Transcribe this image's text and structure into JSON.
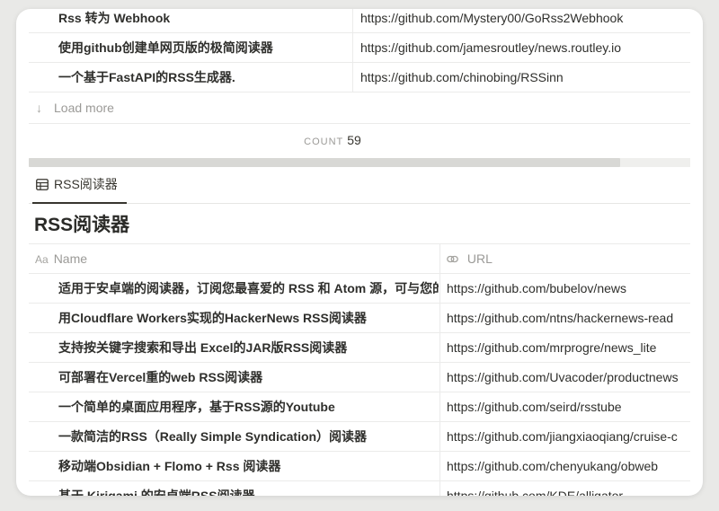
{
  "top_table": {
    "rows": [
      {
        "name": "Rss 转为 Webhook",
        "url": "https://github.com/Mystery00/GoRss2Webhook"
      },
      {
        "name": "使用github创建单网页版的极简阅读器",
        "url": "https://github.com/jamesroutley/news.routley.io"
      },
      {
        "name": "一个基于FastAPI的RSS生成器.",
        "url": "https://github.com/chinobing/RSSinn"
      }
    ],
    "load_more": "Load more",
    "count_label": "COUNT",
    "count_value": "59"
  },
  "view_tab": {
    "label": "RSS阅读器",
    "icon": "table-icon"
  },
  "db": {
    "title": "RSS阅读器",
    "columns": {
      "name": "Name",
      "name_icon": "Aa",
      "url": "URL"
    },
    "rows": [
      {
        "name": "适用于安卓端的阅读器，订阅您最喜爱的 RSS 和 Atom 源，可与您的",
        "url": "https://github.com/bubelov/news"
      },
      {
        "name": "用Cloudflare Workers实现的HackerNews RSS阅读器",
        "url": "https://github.com/ntns/hackernews-read"
      },
      {
        "name": "支持按关键字搜索和导出 Excel的JAR版RSS阅读器",
        "url": "https://github.com/mrprogre/news_lite"
      },
      {
        "name": "可部署在Vercel重的web RSS阅读器",
        "url": "https://github.com/Uvacoder/productnews"
      },
      {
        "name": "一个简单的桌面应用程序，基于RSS源的Youtube",
        "url": "https://github.com/seird/rsstube"
      },
      {
        "name": "一款简洁的RSS（Really Simple Syndication）阅读器",
        "url": "https://github.com/jiangxiaoqiang/cruise-c"
      },
      {
        "name": "移动端Obsidian + Flomo + Rss 阅读器",
        "url": "https://github.com/chenyukang/obweb"
      },
      {
        "name": "基于 Kirigami 的安卓端RSS阅读器",
        "url": "https://github.com/KDE/alligator"
      }
    ]
  }
}
